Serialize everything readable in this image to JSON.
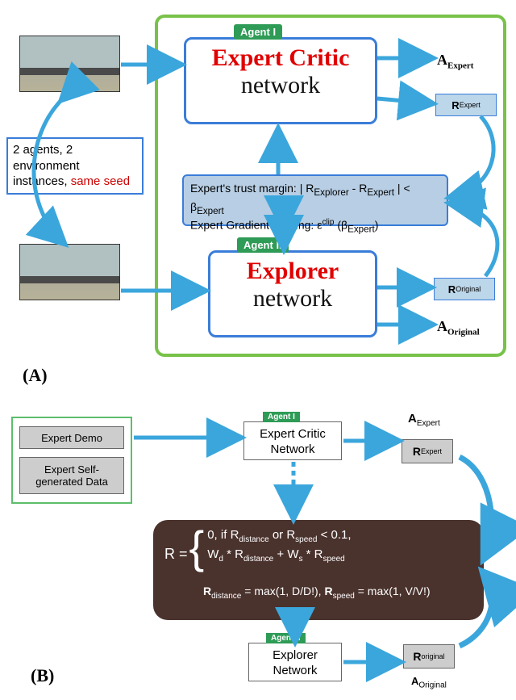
{
  "panelA_label": "(A)",
  "panelB_label": "(B)",
  "env_line1": "2 agents, 2 environment",
  "env_line2_a": "instances, ",
  "env_line2_b": "same seed",
  "agent1_tag": "Agent I",
  "agent2_tag": "Agent II",
  "net1_title": "Expert Critic",
  "net1_sub": "network",
  "net2_title": "Explorer",
  "net2_sub": "network",
  "trust_line1": "Expert's trust margin: | R",
  "trust_line1_sub1": "Explorer",
  "trust_line1_mid": " - R",
  "trust_line1_sub2": "Expert",
  "trust_line1_end": " | < β",
  "trust_line1_sub3": "Expert",
  "trust_line2_a": "Expert Gradient clipping: ε",
  "trust_line2_sup": "clip",
  "trust_line2_b": " (β",
  "trust_line2_sub": "Expert",
  "trust_line2_c": ")",
  "A_expert": "A",
  "A_expert_sub": "Expert",
  "R_expert": "R",
  "R_expert_sub": "Expert",
  "R_original": "R",
  "R_original_sub": "Original",
  "A_original": "A",
  "A_original_sub": "Original",
  "b_demo": "Expert Demo",
  "b_self": "Expert Self-generated Data",
  "b_net1": "Expert Critic Network",
  "b_net2": "Explorer Network",
  "b_agent1": "Agent I",
  "b_agent2": "Agent II",
  "b_A_expert": "A",
  "b_A_expert_sub": "Expert",
  "b_R_expert": "R",
  "b_R_expert_sub": "Expert",
  "b_R_orig": "R",
  "b_R_orig_sub": "original",
  "b_A_orig": "A",
  "b_A_orig_sub": "Original",
  "f_R": "R = ",
  "f_l1a": "0, if R",
  "f_l1a_sub": "distance",
  "f_l1b": " or R",
  "f_l1b_sub": "speed",
  "f_l1c": " < 0.1,",
  "f_l2a": "W",
  "f_l2a_sub": "d",
  "f_l2b": " * R",
  "f_l2b_sub": "distance",
  "f_l2c": " + W",
  "f_l2c_sub": "s",
  "f_l2d": " * R",
  "f_l2d_sub": "speed",
  "f_l3a": "R",
  "f_l3a_sub": "distance",
  "f_l3b": " = max(1, D/D!), ",
  "f_l3c": "R",
  "f_l3c_sub": "speed",
  "f_l3d": " = max(1, V/V!)"
}
